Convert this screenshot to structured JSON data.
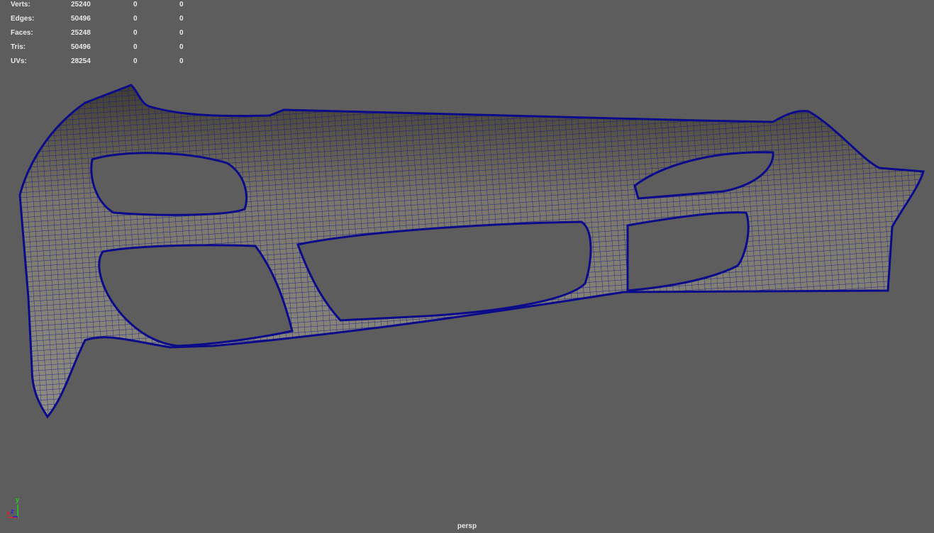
{
  "stats": [
    {
      "label": "Verts:",
      "total": "25240",
      "selected": "0",
      "uv": "0"
    },
    {
      "label": "Edges:",
      "total": "50496",
      "selected": "0",
      "uv": "0"
    },
    {
      "label": "Faces:",
      "total": "25248",
      "selected": "0",
      "uv": "0"
    },
    {
      "label": "Tris:",
      "total": "50496",
      "selected": "0",
      "uv": "0"
    },
    {
      "label": "UVs:",
      "total": "28254",
      "selected": "0",
      "uv": "0"
    }
  ],
  "camera_label": "persp",
  "axis": {
    "x": "x",
    "y": "y",
    "z": "z"
  },
  "colors": {
    "background": "#5d5d5d",
    "wire": "#0a0a8a",
    "x_axis": "#e02020",
    "y_axis": "#20d020",
    "z_axis": "#2020e0"
  }
}
